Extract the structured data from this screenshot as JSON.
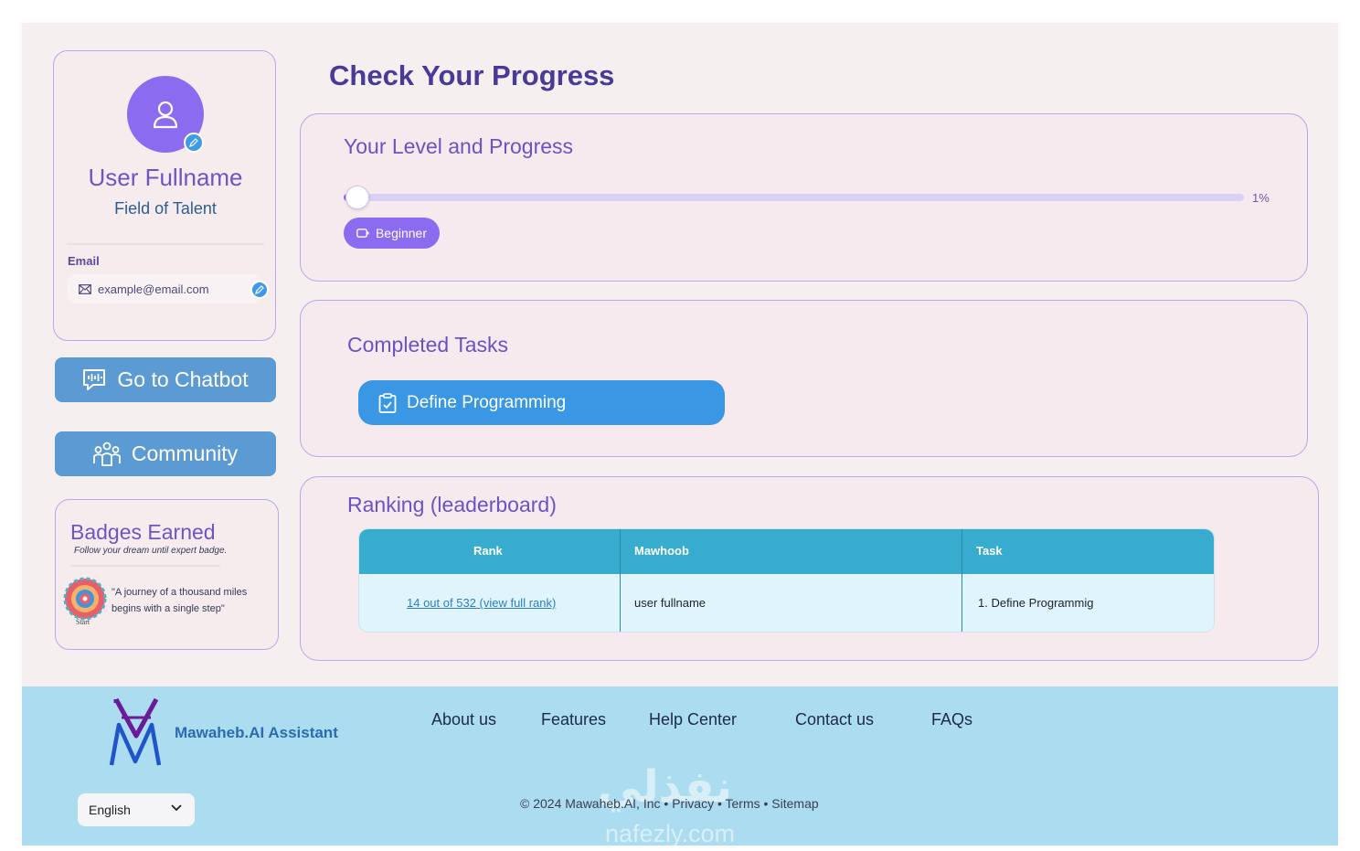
{
  "profile": {
    "name": "User Fullname",
    "field": "Field of Talent",
    "email_label": "Email",
    "email": "example@email.com"
  },
  "sidebar": {
    "chatbot_label": "Go to Chatbot",
    "community_label": "Community"
  },
  "badges": {
    "title": "Badges Earned",
    "subtitle": "Follow your dream until expert badge.",
    "badge_caption": "Start",
    "quote": "\"A journey of a thousand miles begins with a single step\""
  },
  "main": {
    "title": "Check Your Progress"
  },
  "level": {
    "title": "Your Level and Progress",
    "progress_percent": 1,
    "progress_label": "1%",
    "level_name": "Beginner"
  },
  "tasks": {
    "title": "Completed Tasks",
    "items": [
      "Define Programming"
    ]
  },
  "ranking": {
    "title": "Ranking (leaderboard)",
    "columns": [
      "Rank",
      "Mawhoob",
      "Task"
    ],
    "rows": [
      {
        "rank": "14  out of 532 (view full rank)",
        "mawhoob": "user fullname",
        "task": "1.  Define Programmig"
      }
    ]
  },
  "footer": {
    "brand": "Mawaheb.AI Assistant",
    "nav": [
      "About us",
      "Features",
      "Help Center",
      "Contact us",
      "FAQs"
    ],
    "language": "English",
    "copyright": "© 2024 Mawaheb.AI, Inc • Privacy • Terms • Sitemap",
    "watermark_ar": "نفذلي",
    "watermark_en": "nafezly.com"
  },
  "colors": {
    "accent_purple": "#8b6cf1",
    "title_purple": "#4a3a98",
    "button_blue": "#5c9ad3",
    "task_blue": "#3a97e3",
    "table_header": "#38acce",
    "footer_bg": "#acdcef"
  }
}
